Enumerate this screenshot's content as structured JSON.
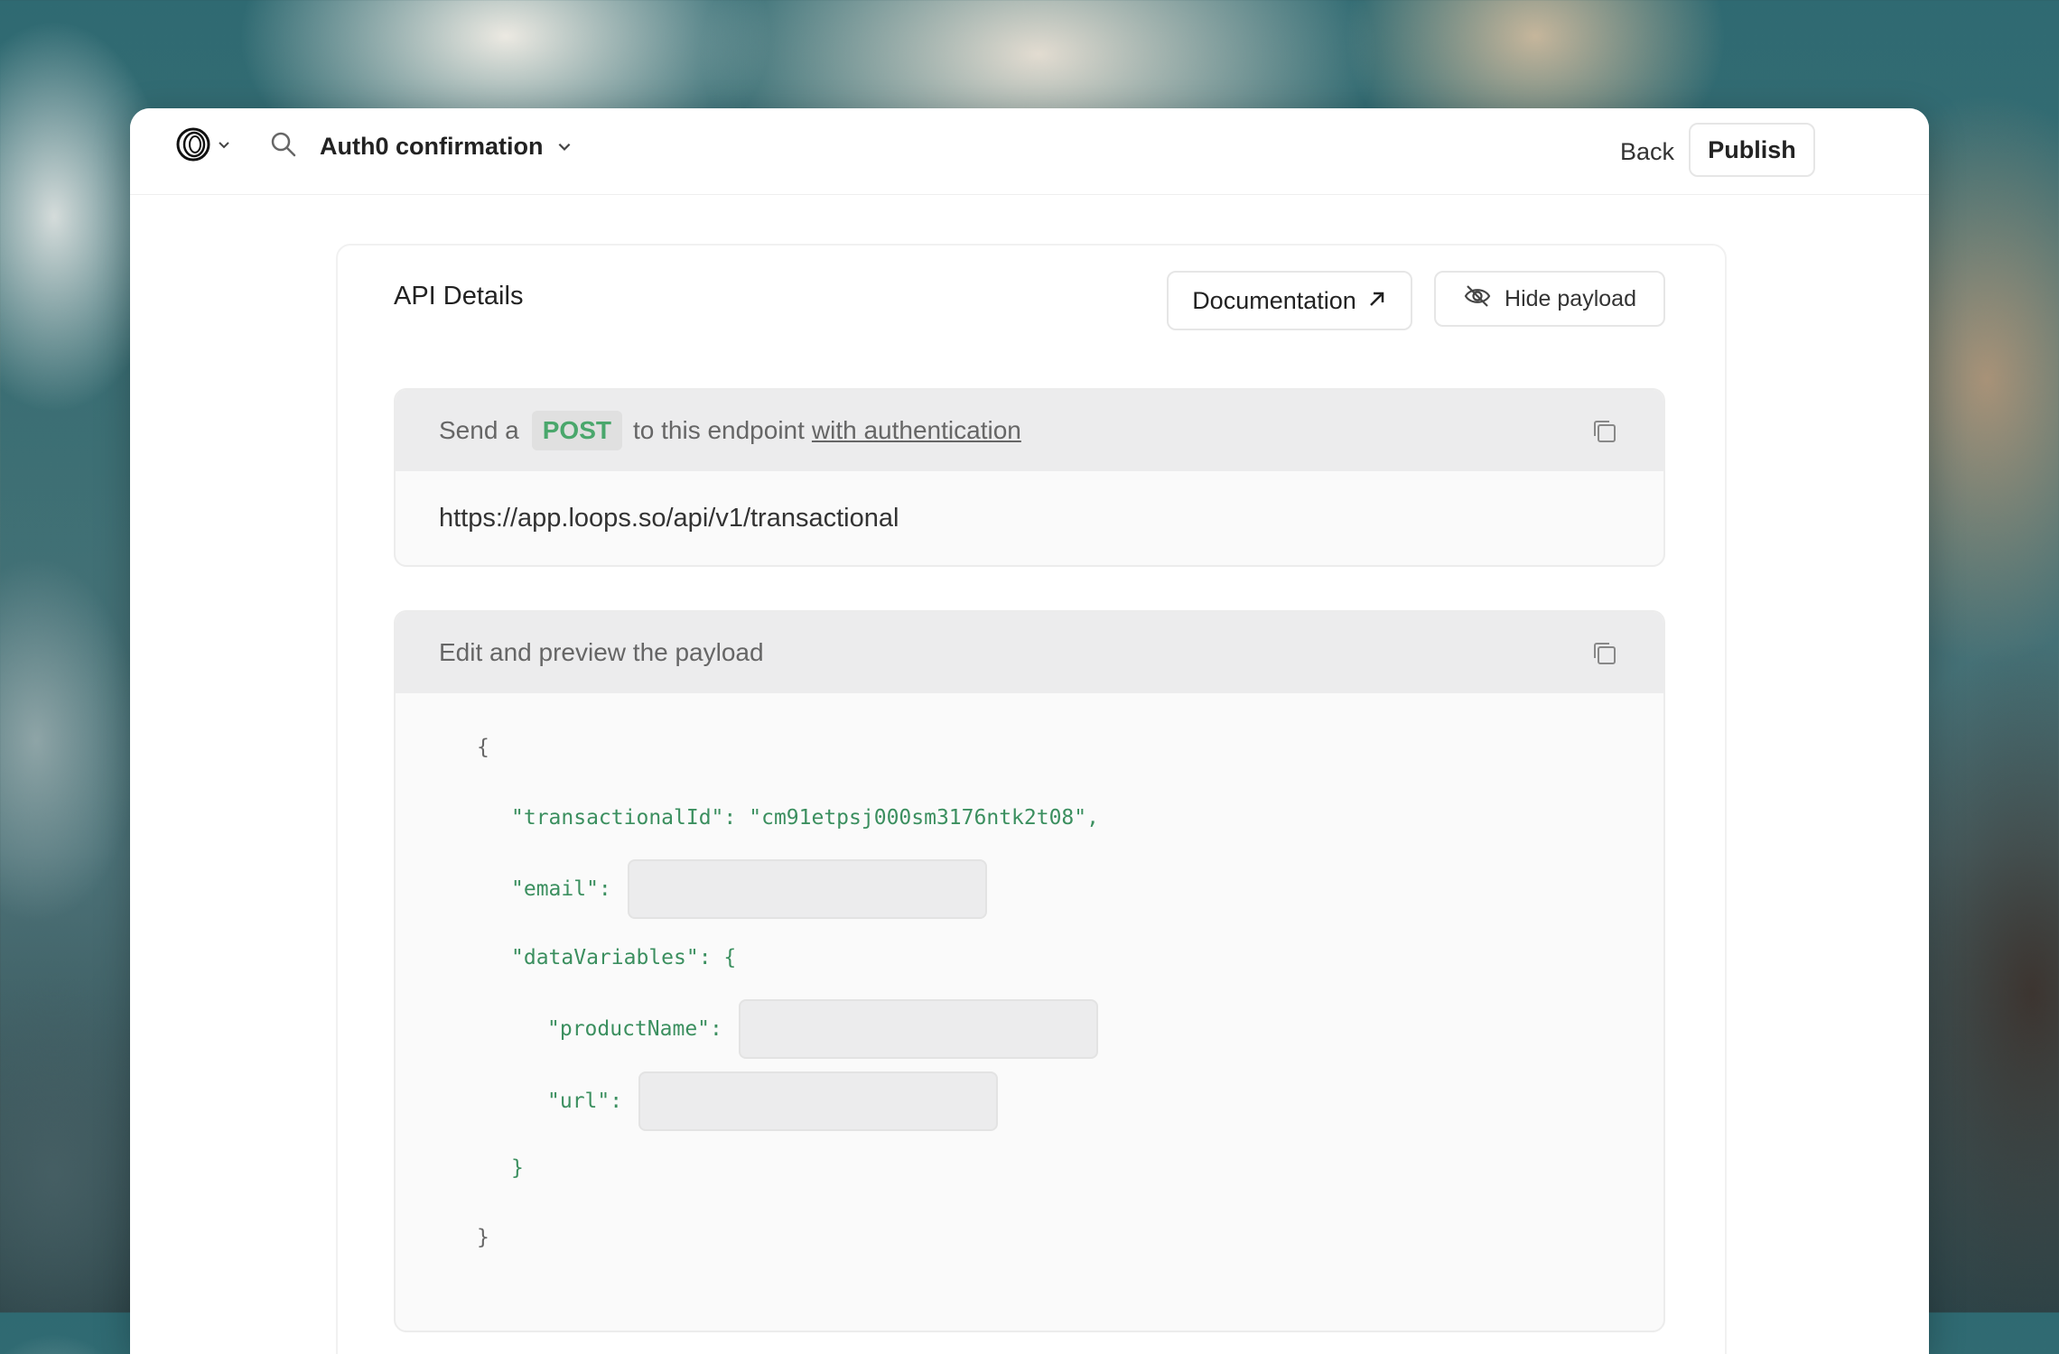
{
  "header": {
    "title": "Auth0 confirmation",
    "back_label": "Back",
    "publish_label": "Publish"
  },
  "card": {
    "title": "API Details",
    "documentation_label": "Documentation",
    "hide_payload_label": "Hide payload"
  },
  "endpoint_panel": {
    "prefix": "Send a",
    "method": "POST",
    "middle": "to this endpoint",
    "auth_link": "with authentication",
    "url": "https://app.loops.so/api/v1/transactional"
  },
  "payload_panel": {
    "header": "Edit and preview the payload",
    "open_brace": "{",
    "close_brace": "}",
    "transactional_key": "\"transactionalId\":",
    "transactional_value": "\"cm91etpsj000sm3176ntk2t08\",",
    "email_key": "\"email\":",
    "email_value": "",
    "data_vars_key": "\"dataVariables\": {",
    "product_key": "\"productName\":",
    "product_value": "",
    "url_key": "\"url\":",
    "url_value": "",
    "inner_close": "}"
  },
  "colors": {
    "accent_green": "#3b8f5f",
    "method_green": "#4aa76c"
  },
  "icons": [
    "loops-logo-icon",
    "chevron-down-icon",
    "search-icon",
    "arrow-up-right-icon",
    "eye-off-icon",
    "copy-icon"
  ]
}
